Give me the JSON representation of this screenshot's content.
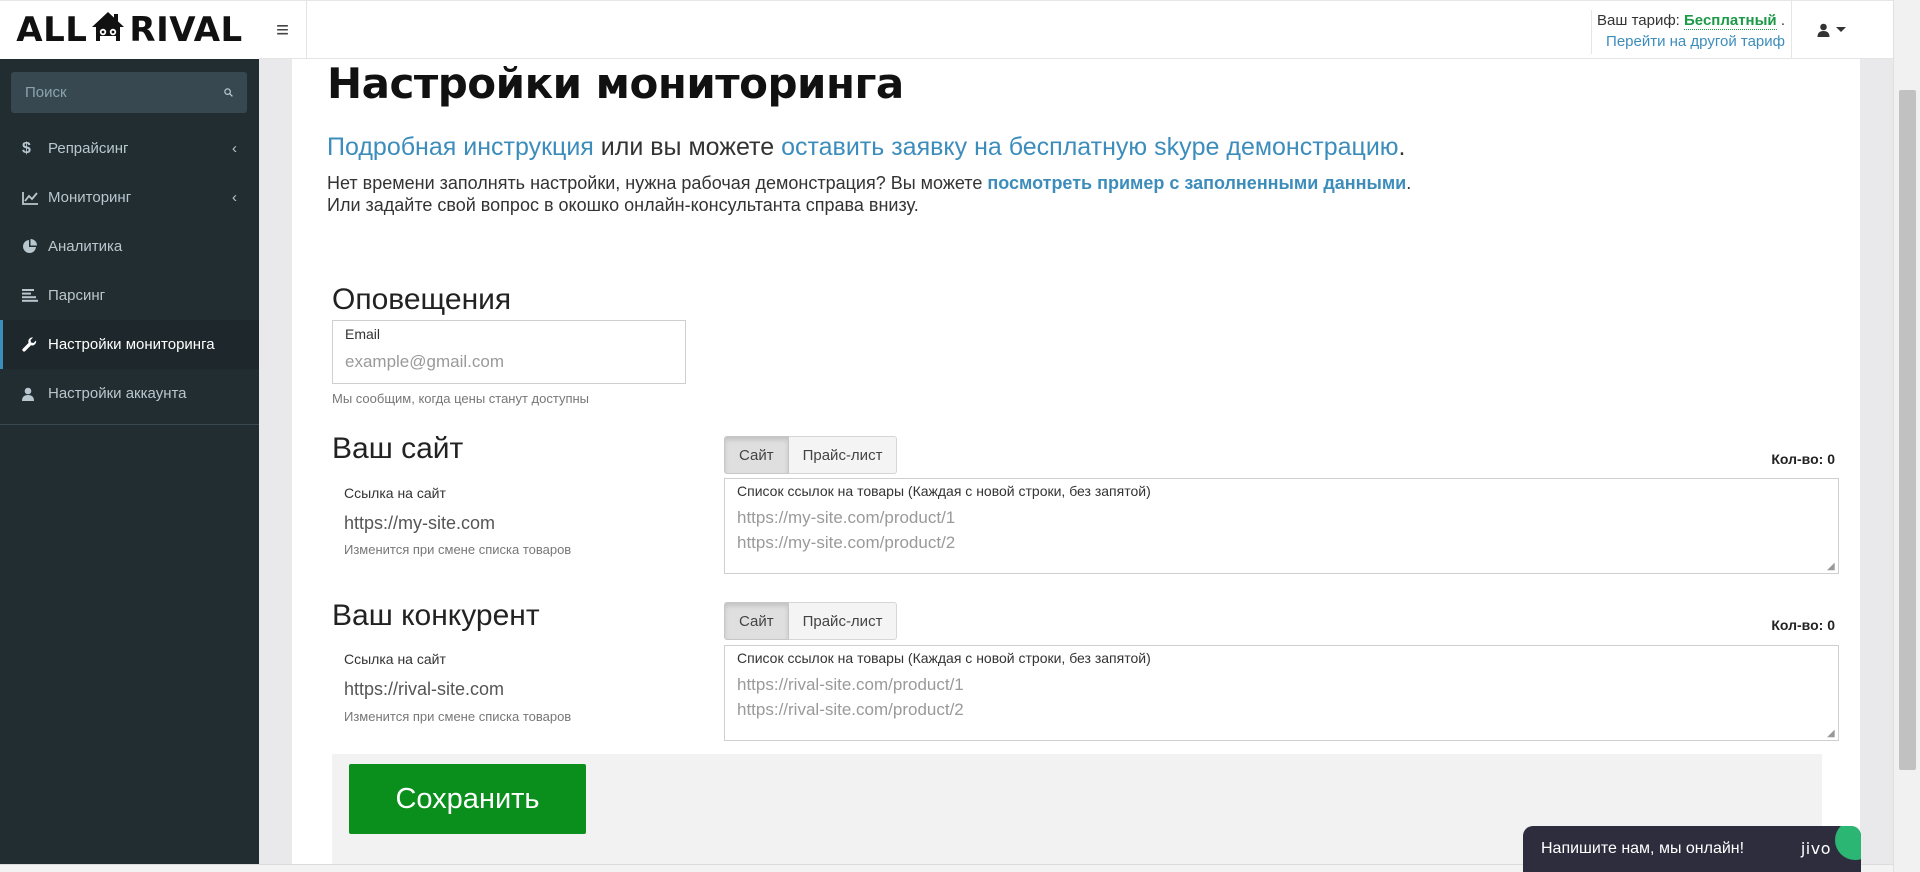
{
  "brand": {
    "left": "ALL",
    "right": "RIVAL"
  },
  "header": {
    "tariff_label": "Ваш тариф:",
    "tariff_value": "Бесплатный",
    "tariff_dot": ".",
    "tariff_change": "Перейти на другой тариф"
  },
  "sidebar": {
    "search_placeholder": "Поиск",
    "items": [
      {
        "label": "Репрайсинг",
        "icon": "dollar-icon",
        "has_chevron": true,
        "active": false
      },
      {
        "label": "Мониторинг",
        "icon": "line-chart-icon",
        "has_chevron": true,
        "active": false
      },
      {
        "label": "Аналитика",
        "icon": "pie-chart-icon",
        "has_chevron": false,
        "active": false
      },
      {
        "label": "Парсинг",
        "icon": "list-icon",
        "has_chevron": false,
        "active": false
      },
      {
        "label": "Настройки мониторинга",
        "icon": "wrench-icon",
        "has_chevron": false,
        "active": true
      },
      {
        "label": "Настройки аккаунта",
        "icon": "user-icon",
        "has_chevron": false,
        "active": false
      }
    ]
  },
  "main": {
    "title": "Настройки мониторинга",
    "intro_link1": "Подробная инструкция",
    "intro_middle": " или вы можете ",
    "intro_link2": "оставить заявку на бесплатную skype демонстрацию",
    "intro_end": ".",
    "desc_line1_start": "Нет времени заполнять настройки, нужна рабочая демонстрация? Вы можете ",
    "desc_link": "посмотреть пример с заполненными данными",
    "desc_line1_end": ".",
    "desc_line2": "Или задайте свой вопрос в окошко онлайн-консультанта справа внизу.",
    "notifications": {
      "title": "Оповещения",
      "email_label": "Email",
      "email_placeholder": "example@gmail.com",
      "help": "Мы сообщим, когда цены станут доступны"
    },
    "your_site": {
      "title": "Ваш сайт",
      "link_label": "Ссылка на сайт",
      "link_value": "https://my-site.com",
      "help": "Изменится при смене списка товаров",
      "btn_site": "Сайт",
      "btn_price": "Прайс-лист",
      "count": "Кол-во: 0",
      "list_label": "Список ссылок на товары (Каждая с новой строки, без запятой)",
      "list_placeholder": "https://my-site.com/product/1\nhttps://my-site.com/product/2"
    },
    "competitor": {
      "title": "Ваш конкурент",
      "link_label": "Ссылка на сайт",
      "link_value": "https://rival-site.com",
      "help": "Изменится при смене списка товаров",
      "btn_site": "Сайт",
      "btn_price": "Прайс-лист",
      "count": "Кол-во: 0",
      "list_label": "Список ссылок на товары (Каждая с новой строки, без запятой)",
      "list_placeholder": "https://rival-site.com/product/1\nhttps://rival-site.com/product/2"
    },
    "save_label": "Сохранить"
  },
  "chat": {
    "text": "Напишите нам, мы онлайн!",
    "logo": "jivo"
  },
  "colors": {
    "sidebar_bg": "#222d32",
    "link": "#3c8dbc",
    "save_btn": "#0a8f1c",
    "tariff_value": "#1c9a47"
  }
}
